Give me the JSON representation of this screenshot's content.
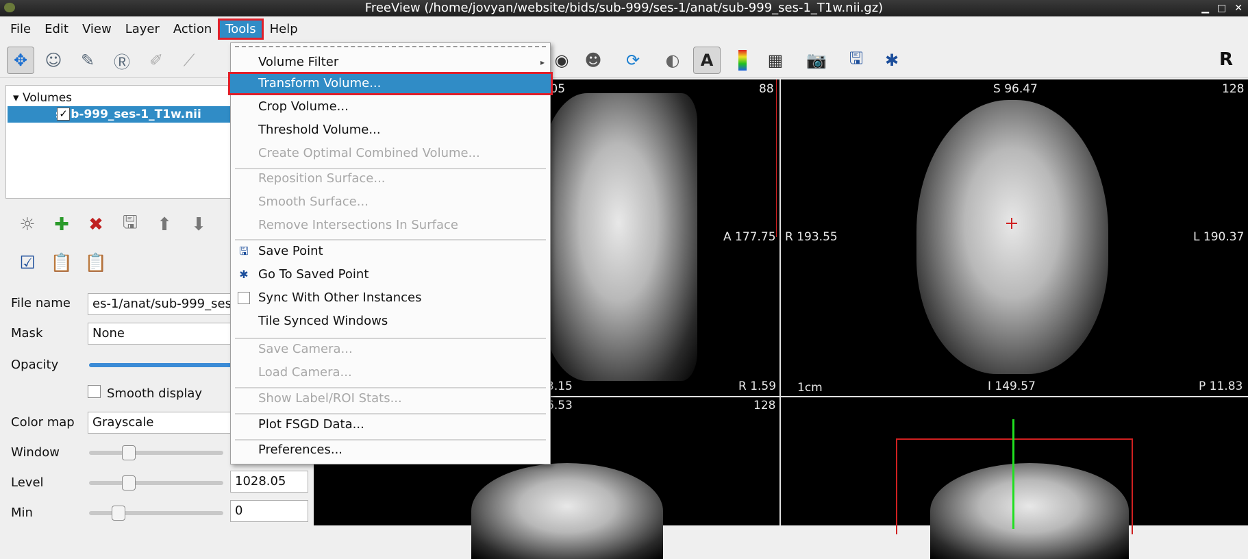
{
  "window": {
    "title": "FreeView (/home/jovyan/website/bids/sub-999/ses-1/anat/sub-999_ses-1_T1w.nii.gz)",
    "controls": [
      "▁",
      "□",
      "✕"
    ]
  },
  "menubar": {
    "items": [
      "File",
      "Edit",
      "View",
      "Layer",
      "Action",
      "Tools",
      "Help"
    ],
    "active": "Tools"
  },
  "toolbar": {
    "right_label": "R"
  },
  "layer_panel": {
    "root": "Volumes",
    "child": "sub-999_ses-1_T1w.nii",
    "child_checked": "✓"
  },
  "properties": {
    "file_name_label": "File name",
    "file_name_value": "es-1/anat/sub-999_ses-",
    "mask_label": "Mask",
    "mask_value": "None",
    "opacity_label": "Opacity",
    "opacity_fraction": 1.0,
    "smooth_label": "Smooth display",
    "colormap_label": "Color map",
    "colormap_value": "Grayscale",
    "window_label": "Window",
    "window_fraction": 0.27,
    "level_label": "Level",
    "level_value": "1028.05",
    "level_fraction": 0.27,
    "min_label": "Min",
    "min_value": "0",
    "min_fraction": 0.19
  },
  "views": {
    "sagittal": {
      "top_left": ".05",
      "top_right": "88",
      "mid_right": "A 177.75",
      "bottom_left": "3.15",
      "bottom_right": "R 1.59"
    },
    "coronal": {
      "top_center": "S 96.47",
      "top_right": "128",
      "mid_left": "R 193.55",
      "mid_right": "L 190.37",
      "scale": "1cm",
      "bottom_center": "I 149.57",
      "bottom_right": "P 11.83"
    },
    "axial": {
      "top_left": "6.53",
      "top_right": "128"
    }
  },
  "tools_menu": {
    "items": [
      {
        "label": "Volume Filter",
        "enabled": true,
        "submenu": "▸"
      },
      {
        "label": "Transform Volume...",
        "enabled": true,
        "highlighted": true
      },
      {
        "label": "Crop Volume...",
        "enabled": true
      },
      {
        "label": "Threshold Volume...",
        "enabled": true
      },
      {
        "label": "Create Optimal Combined Volume...",
        "enabled": false
      },
      {
        "label": "Reposition Surface...",
        "enabled": false
      },
      {
        "label": "Smooth Surface...",
        "enabled": false
      },
      {
        "label": "Remove Intersections In Surface",
        "enabled": false
      },
      {
        "label": "Save Point",
        "enabled": true,
        "icon": "save-point-icon"
      },
      {
        "label": "Go To Saved Point",
        "enabled": true,
        "icon": "goto-point-icon"
      },
      {
        "label": "Sync With Other Instances",
        "enabled": true,
        "checkable": true
      },
      {
        "label": "Tile Synced Windows",
        "enabled": true
      },
      {
        "label": "Save Camera...",
        "enabled": false
      },
      {
        "label": "Load Camera...",
        "enabled": false
      },
      {
        "label": "Show Label/ROI Stats...",
        "enabled": false
      },
      {
        "label": "Plot FSGD Data...",
        "enabled": true
      },
      {
        "label": "Preferences...",
        "enabled": true
      }
    ]
  }
}
